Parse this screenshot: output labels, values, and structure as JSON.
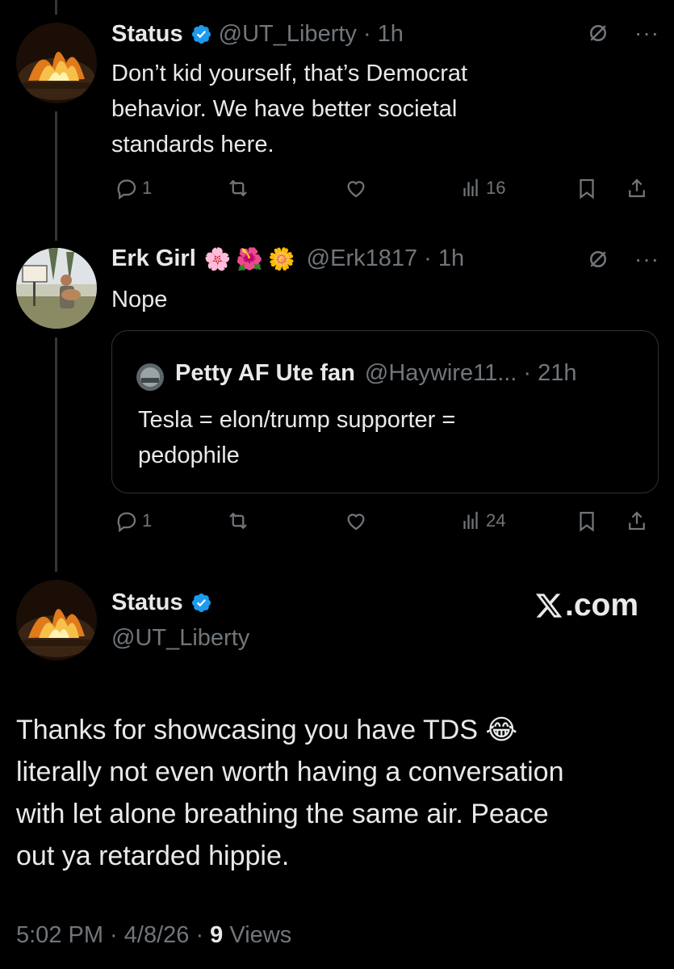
{
  "tweets": [
    {
      "name": "Status",
      "handle": "@UT_Liberty · 1h",
      "text_lines": [
        "Don’t kid yourself, that’s Democrat",
        "behavior. We have better societal",
        "standards here."
      ],
      "replies": "1",
      "views": "16"
    },
    {
      "name": "Erk Girl",
      "emojis": [
        "🌸",
        "🌺",
        "🌼"
      ],
      "handle": "@Erk1817 · 1h",
      "text": "Nope",
      "quote": {
        "name": "Petty AF Ute fan",
        "handle": "@Haywire11... · 21h",
        "text_lines": [
          "Tesla = elon/trump supporter =",
          "pedophile"
        ]
      },
      "replies": "1",
      "views": "24"
    }
  ],
  "main": {
    "name": "Status",
    "handle": "@UT_Liberty",
    "brand": ".com",
    "text_lines": [
      "Thanks for showcasing you have TDS 😂",
      "literally not even worth having a conversation",
      "with let alone breathing the same air. Peace",
      "out ya retarded hippie."
    ],
    "meta_time": "5:02 PM · 4/8/26 · ",
    "meta_views_count": "9",
    "meta_views_label": " Views"
  },
  "icons": {
    "reply": "reply-icon",
    "repost": "repost-icon",
    "like": "like-icon",
    "views": "views-icon",
    "bookmark": "bookmark-icon",
    "share": "share-icon",
    "grok": "grok-icon",
    "more": "more-icon",
    "verified": "verified-badge-icon"
  },
  "colors": {
    "background": "#000000",
    "text": "#e7e9ea",
    "secondary": "#71767b",
    "verified": "#1d9bf0",
    "border": "#2f3336"
  }
}
